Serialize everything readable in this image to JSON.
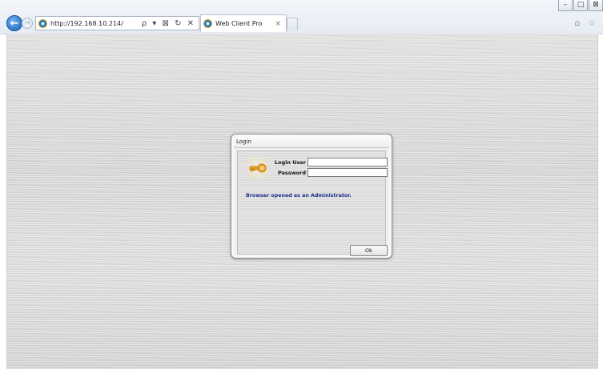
{
  "browser": {
    "address": "http://192.168.10.214/",
    "address_tools": "ρ ▾ ⊠ ↻ ✕",
    "tab_title": "Web Client Pro",
    "tab_close": "×",
    "window_controls": [
      "–",
      "□",
      "⊠"
    ],
    "back_icon": "arrow-left-icon",
    "forward_icon": "arrow-right-icon",
    "right_tools": "⌂ ☆"
  },
  "login_dialog": {
    "title": "Login",
    "login_user_label": "Login User",
    "password_label": "Password",
    "login_user_value": "",
    "password_value": "",
    "message": "Browser opened as an Administrator.",
    "ok_label": "Ok"
  },
  "colors": {
    "message_text": "#1c2f86",
    "key_gold": "#e6a21e"
  }
}
